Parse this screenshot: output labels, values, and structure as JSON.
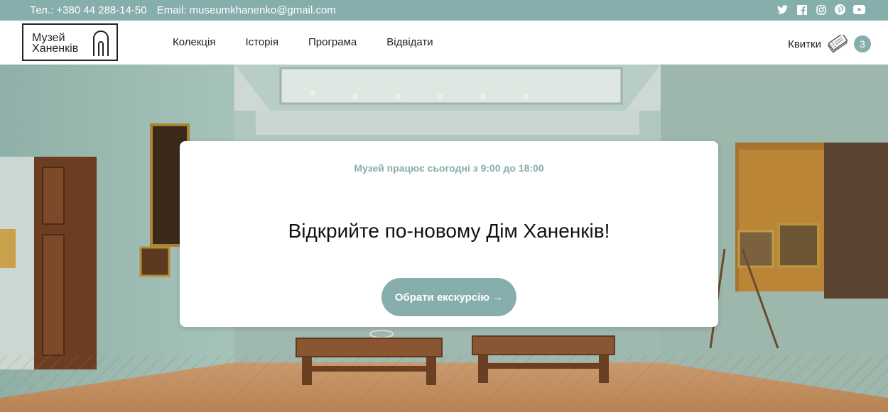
{
  "topbar": {
    "phone": "Тел.: +380 44 288-14-50",
    "email": "Email: museumkhanenko@gmail.com",
    "socials": [
      "twitter-icon",
      "facebook-icon",
      "instagram-icon",
      "pinterest-icon",
      "youtube-icon"
    ]
  },
  "logo": {
    "line1": "Музей",
    "line2": "Ханенків"
  },
  "nav": [
    {
      "label": "Колекція"
    },
    {
      "label": "Історія"
    },
    {
      "label": "Програма"
    },
    {
      "label": "Відвідати"
    }
  ],
  "tickets": {
    "label": "Квитки",
    "count": "3",
    "icon": "ticket-icon"
  },
  "hero": {
    "hours": "Музей працює сьогодні з 9:00 до 18:00",
    "headline": "Відкрийте по-новому Дім Ханенків!",
    "cta": "Обрати екскурсію →"
  },
  "colors": {
    "accent": "#86aead",
    "text": "#111111"
  }
}
